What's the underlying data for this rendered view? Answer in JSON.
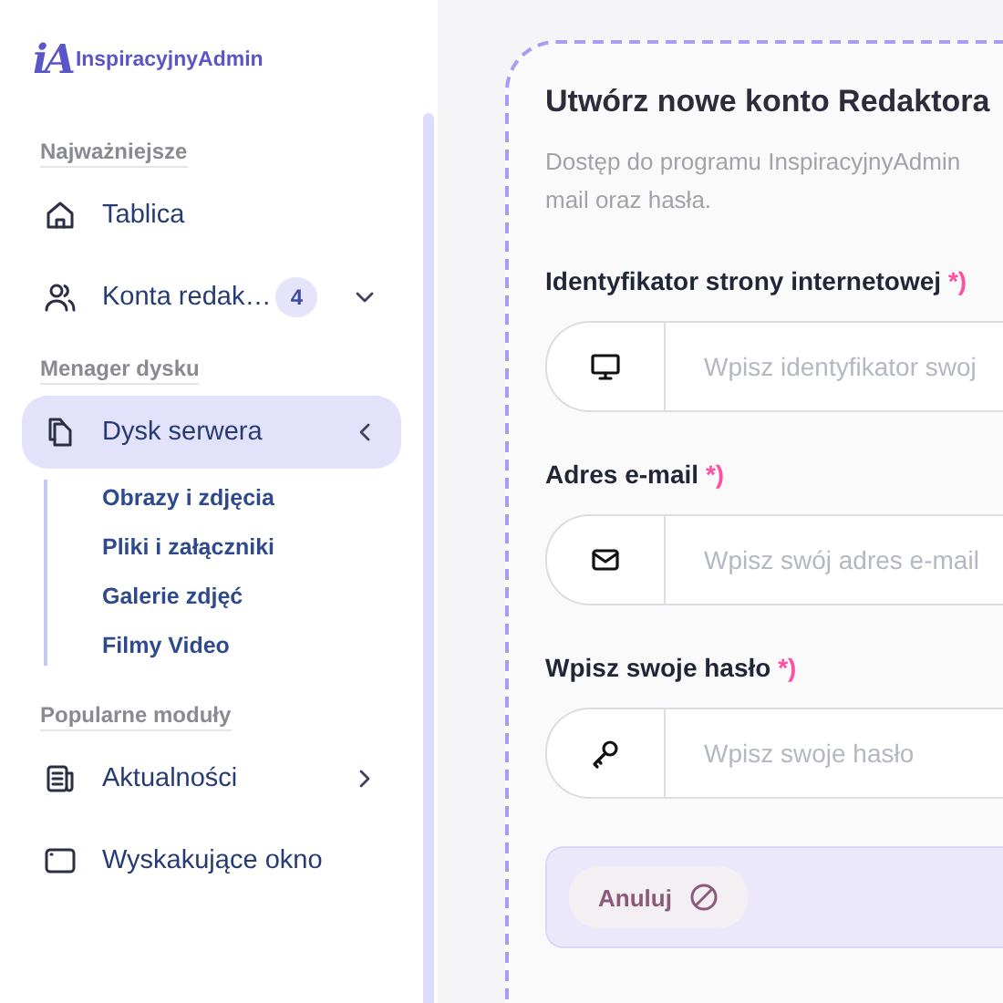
{
  "sidebar": {
    "logo_mark": "iA",
    "logo_text": "InspiracyjnyAdmin",
    "sections": [
      {
        "title": "Najważniejsze",
        "items": [
          {
            "label": "Tablica",
            "kind": "link",
            "selected": false
          },
          {
            "label": "Konta redak…",
            "kind": "dropdown",
            "badge": "4",
            "expanded": false,
            "selected": false
          }
        ]
      },
      {
        "title": "Menager dysku",
        "items": [
          {
            "label": "Dysk serwera",
            "kind": "submenu",
            "expanded": true,
            "selected": true,
            "children": [
              {
                "label": "Obrazy i zdjęcia"
              },
              {
                "label": "Pliki i załączniki"
              },
              {
                "label": "Galerie zdjęć"
              },
              {
                "label": "Filmy Video"
              }
            ]
          }
        ]
      },
      {
        "title": "Popularne moduły",
        "items": [
          {
            "label": "Aktualności",
            "kind": "submenu",
            "expanded": false,
            "selected": false
          },
          {
            "label": "Wyskakujące okno",
            "kind": "link",
            "selected": false
          }
        ]
      }
    ]
  },
  "form": {
    "title": "Utwórz nowe konto Redaktora",
    "description_lines": [
      "Dostęp do programu InspiracyjnyAdmin",
      "mail oraz hasła."
    ],
    "fields": [
      {
        "label": "Identyfikator strony internetowej",
        "required_mark": "*)",
        "placeholder": "Wpisz identyfikator swoj"
      },
      {
        "label": "Adres e-mail",
        "required_mark": "*)",
        "placeholder": "Wpisz swój adres e-mail"
      },
      {
        "label": "Wpisz swoje hasło",
        "required_mark": "*)",
        "placeholder": "Wpisz swoje hasło"
      }
    ],
    "cancel_button": "Anuluj"
  }
}
